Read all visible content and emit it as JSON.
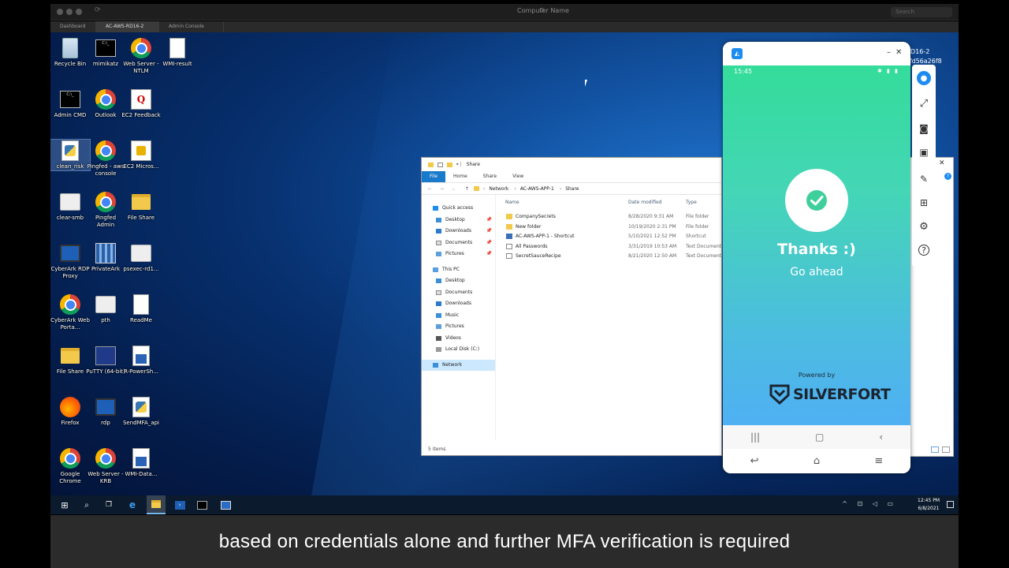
{
  "browser": {
    "title": "Computer Name",
    "search_placeholder": "Search",
    "tabs": [
      {
        "label": "Dashboard"
      },
      {
        "label": "AC-AWS-RD16-2"
      },
      {
        "label": "Admin Console"
      }
    ]
  },
  "desktop": {
    "icons": [
      {
        "label": "Recycle Bin",
        "icon": "recycle-bin-icon"
      },
      {
        "label": "mimikatz",
        "icon": "terminal-icon"
      },
      {
        "label": "Web Server - NTLM",
        "icon": "chrome-icon"
      },
      {
        "label": "WMI-result",
        "icon": "document-icon"
      },
      {
        "label": "Admin CMD",
        "icon": "terminal-icon"
      },
      {
        "label": "Outlook",
        "icon": "chrome-icon"
      },
      {
        "label": "EC2 Feedback",
        "icon": "feedback-icon"
      },
      {
        "label": "clean_risk",
        "icon": "python-file-icon"
      },
      {
        "label": "Pingfed - aws console",
        "icon": "chrome-icon"
      },
      {
        "label": "EC2 Micros...",
        "icon": "ec2-icon"
      },
      {
        "label": "clear-smb",
        "icon": "gears-icon"
      },
      {
        "label": "Pingfed Admin",
        "icon": "chrome-icon"
      },
      {
        "label": "File Share",
        "icon": "folder-share-icon"
      },
      {
        "label": "CyberArk RDP Proxy",
        "icon": "rdp-icon"
      },
      {
        "label": "PrivateArk",
        "icon": "privateark-icon"
      },
      {
        "label": "psexec-rd1...",
        "icon": "gears-icon"
      },
      {
        "label": "CyberArk Web Porta...",
        "icon": "chrome-icon"
      },
      {
        "label": "pth",
        "icon": "gears-icon"
      },
      {
        "label": "ReadMe",
        "icon": "document-icon"
      },
      {
        "label": "File Share",
        "icon": "folder-share-icon"
      },
      {
        "label": "PuTTY (64-bit)",
        "icon": "putty-icon"
      },
      {
        "label": "R-PowerSh...",
        "icon": "powershell-script-icon"
      },
      {
        "label": "Firefox",
        "icon": "firefox-icon"
      },
      {
        "label": "rdp",
        "icon": "rdp-icon"
      },
      {
        "label": "SendMFA_api",
        "icon": "python-file-icon"
      },
      {
        "label": "Google Chrome",
        "icon": "chrome-icon"
      },
      {
        "label": "Web Server - KRB",
        "icon": "chrome-icon"
      },
      {
        "label": "WMI-Data...",
        "icon": "powershell-script-icon"
      }
    ]
  },
  "explorer": {
    "title": "Share",
    "ribbon_tabs": [
      "File",
      "Home",
      "Share",
      "View"
    ],
    "breadcrumb": [
      "Network",
      "AC-AWS-APP-1",
      "Share"
    ],
    "nav": [
      {
        "label": "Quick access",
        "level": 0,
        "pinned": false
      },
      {
        "label": "Desktop",
        "level": 1,
        "pinned": true
      },
      {
        "label": "Downloads",
        "level": 1,
        "pinned": true
      },
      {
        "label": "Documents",
        "level": 1,
        "pinned": true
      },
      {
        "label": "Pictures",
        "level": 1,
        "pinned": true
      },
      {
        "label": "",
        "level": 0,
        "pinned": false
      },
      {
        "label": "This PC",
        "level": 0,
        "pinned": false
      },
      {
        "label": "Desktop",
        "level": 1,
        "pinned": false
      },
      {
        "label": "Documents",
        "level": 1,
        "pinned": false
      },
      {
        "label": "Downloads",
        "level": 1,
        "pinned": false
      },
      {
        "label": "Music",
        "level": 1,
        "pinned": false
      },
      {
        "label": "Pictures",
        "level": 1,
        "pinned": false
      },
      {
        "label": "Videos",
        "level": 1,
        "pinned": false
      },
      {
        "label": "Local Disk (C:)",
        "level": 1,
        "pinned": false
      },
      {
        "label": "",
        "level": 0,
        "pinned": false
      },
      {
        "label": "Network",
        "level": 0,
        "pinned": false
      }
    ],
    "columns": [
      "Name",
      "Date modified",
      "Type"
    ],
    "files": [
      {
        "name": "CompanySecrets",
        "date": "8/28/2020 9:31 AM",
        "type": "File folder",
        "icon": "folder-icon"
      },
      {
        "name": "New folder",
        "date": "10/19/2020 2:31 PM",
        "type": "File folder",
        "icon": "folder-icon"
      },
      {
        "name": "AC-AWS-APP-1 - Shortcut",
        "date": "5/10/2021 12:52 PM",
        "type": "Shortcut",
        "icon": "shortcut-icon"
      },
      {
        "name": "All Passwords",
        "date": "3/31/2019 10:53 AM",
        "type": "Text Document",
        "icon": "text-file-icon"
      },
      {
        "name": "SecretSauceRecipe",
        "date": "8/21/2020 12:50 AM",
        "type": "Text Document",
        "icon": "text-file-icon"
      }
    ],
    "status": "5 items"
  },
  "phone": {
    "time": "15:45",
    "thanks": "Thanks :)",
    "subtitle": "Go ahead",
    "powered_by": "Powered by",
    "brand": "SILVERFORT"
  },
  "peek": {
    "line1": "D16-2",
    "line2": "ffd56a26f8"
  },
  "taskbar": {
    "time": "12:45 PM",
    "date": "6/8/2021"
  },
  "caption": "based on credentials alone and further MFA verification is required",
  "colors": {
    "phone_gradient_top": "#34dc9a",
    "phone_gradient_bottom": "#4fb0f3",
    "ribbon_file": "#1979ca",
    "taskbar": "#0b1a2c"
  }
}
